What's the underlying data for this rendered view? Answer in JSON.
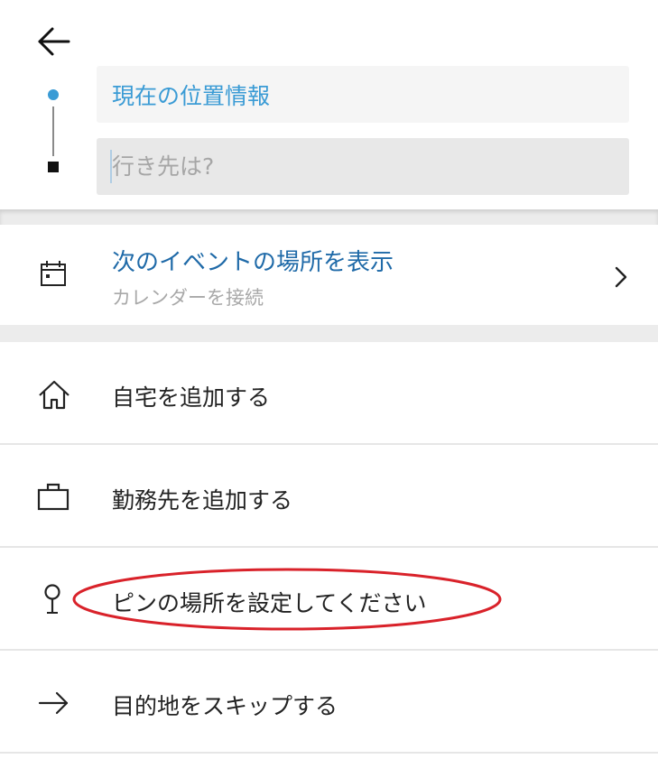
{
  "header": {
    "origin_value": "現在の位置情報",
    "destination_placeholder": "行き先は?"
  },
  "calendar": {
    "title": "次のイベントの場所を表示",
    "subtitle": "カレンダーを接続"
  },
  "list": {
    "items": [
      {
        "label": "自宅を追加する",
        "icon": "home-icon"
      },
      {
        "label": "勤務先を追加する",
        "icon": "briefcase-icon"
      },
      {
        "label": "ピンの場所を設定してください",
        "icon": "pin-icon"
      },
      {
        "label": "目的地をスキップする",
        "icon": "arrow-right-icon"
      }
    ]
  },
  "colors": {
    "accent_blue": "#3a9bd5",
    "link_blue": "#1f6aa8",
    "annotation_red": "#d9222a"
  }
}
